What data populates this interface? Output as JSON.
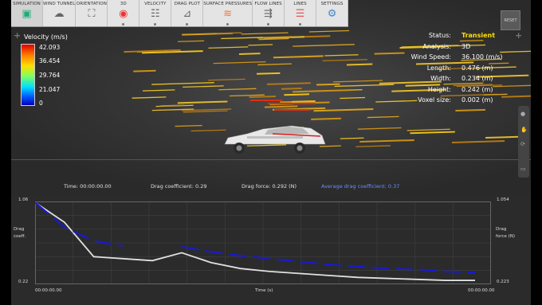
{
  "toolbar": {
    "items": [
      {
        "label": "SIMULATION",
        "icon": "simulation-icon"
      },
      {
        "label": "WIND TUNNEL",
        "icon": "wind-tunnel-icon"
      },
      {
        "label": "ORIENTATION",
        "icon": "orientation-icon"
      },
      {
        "label": "3D",
        "icon": "3d-icon"
      },
      {
        "label": "VELOCITY",
        "icon": "velocity-icon"
      },
      {
        "label": "DRAG PLOT",
        "icon": "drag-plot-icon"
      },
      {
        "label": "SURFACE PRESSURES",
        "icon": "surface-pressures-icon"
      },
      {
        "label": "FLOW LINES",
        "icon": "flow-lines-icon"
      },
      {
        "label": "LINES",
        "icon": "lines-icon"
      },
      {
        "label": "SETTINGS",
        "icon": "settings-icon"
      }
    ],
    "reset_label": "RESET"
  },
  "legend": {
    "title": "Velocity (m/s)",
    "values": [
      "42.093",
      "36.454",
      "29.764",
      "21.047",
      "0"
    ]
  },
  "info": {
    "rows": [
      {
        "key": "Status:",
        "value": "Transient"
      },
      {
        "key": "Analysis:",
        "value": "3D"
      },
      {
        "key": "Wind Speed:",
        "value": "36.100 (m/s)"
      },
      {
        "key": "Length:",
        "value": "0.476 (m)"
      },
      {
        "key": "Width:",
        "value": "0.234 (m)"
      },
      {
        "key": "Height:",
        "value": "0.242 (m)"
      },
      {
        "key": "Voxel size:",
        "value": "0.002 (m)"
      }
    ]
  },
  "stats": {
    "time": "Time: 00:00:00.00",
    "drag_coefficient": "Drag coefficient: 0.29",
    "drag_force": "Drag force: 0.292 (N)",
    "avg_drag": "Average drag coefficient: 0.37"
  },
  "graph": {
    "left_top": "1.06",
    "left_bottom": "0.22",
    "left_label_1": "Drag",
    "left_label_2": "coeff.",
    "right_top": "1.054",
    "right_bottom": "0.223",
    "right_label_1": "Drag",
    "right_label_2": "force (N)",
    "x_start": "00:00:00.00",
    "x_end": "00:00:00.00",
    "x_label": "Time (s)"
  },
  "colors": {
    "drag_coeff_line": "#e0e0e0",
    "avg_line": "#1a1ad0",
    "highlight": "#ffe000"
  },
  "chart_data": {
    "type": "line",
    "xlabel": "Time (s)",
    "ylabel": "Drag coeff.",
    "ylim": [
      0.22,
      1.06
    ],
    "y2label": "Drag force (N)",
    "y2lim": [
      0.223,
      1.054
    ],
    "grid": true,
    "series": [
      {
        "values": [
          1.05,
          0.85,
          0.5,
          0.48,
          0.46,
          0.54,
          0.44,
          0.38,
          0.35,
          0.33,
          0.31,
          0.29,
          0.28,
          0.27,
          0.26,
          0.26
        ]
      },
      {
        "values": [
          1.05,
          0.8,
          0.66,
          0.61,
          null,
          0.6,
          0.55,
          0.51,
          0.48,
          0.45,
          0.42,
          0.4,
          0.38,
          0.37,
          0.35,
          0.34
        ]
      }
    ]
  }
}
